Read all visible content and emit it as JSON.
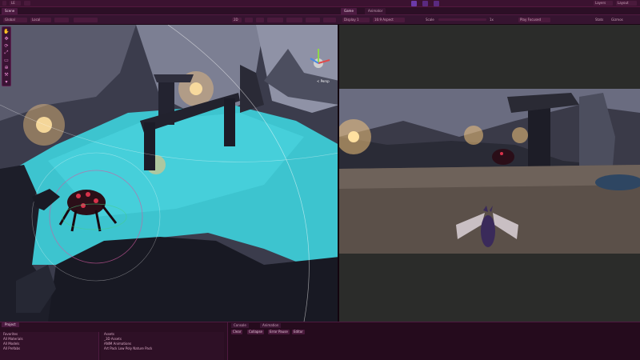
{
  "toolbar": {
    "account": "LE",
    "layers": "Layers",
    "layout": "Layout"
  },
  "tabs": {
    "scene": "Scene",
    "game": "Game",
    "animator": "Animator"
  },
  "scene_toolbar": {
    "shading": "Global",
    "pivot": "Local",
    "view_mode": "2D"
  },
  "game_toolbar": {
    "display": "Display 1",
    "aspect": "16:9 Aspect",
    "scale_label": "Scale",
    "scale_value": "1x",
    "play_mode": "Play Focused",
    "stats": "Stats",
    "gizmos": "Gizmos"
  },
  "gizmo": {
    "persp_label": "< Persp"
  },
  "project": {
    "tab": "Project",
    "favorites_header": "Favorites",
    "favorites": [
      "All Materials",
      "All Models",
      "All Prefabs"
    ],
    "assets_header": "Assets",
    "asset_folders": [
      "_3D Assets",
      "ANIM Animations",
      "Art Pack Low Poly Nature Pack"
    ]
  },
  "console": {
    "tab_console": "Console",
    "tab_animation": "Animation",
    "clear": "Clear",
    "collapse": "Collapse",
    "error_pause": "Error Pause",
    "editor": "Editor"
  },
  "colors": {
    "accent": "#e06ad0",
    "water": "#35c9d6",
    "chrome": "#3b1230"
  }
}
